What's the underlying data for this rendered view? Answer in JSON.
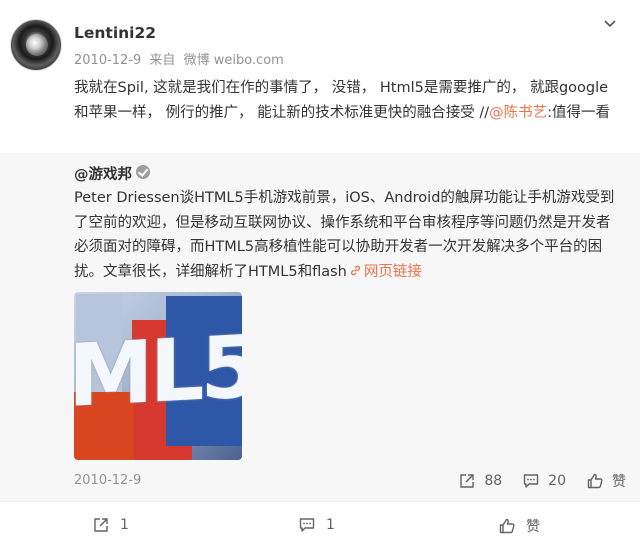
{
  "post": {
    "username": "Lentini22",
    "date": "2010-12-9",
    "source_prefix": "来自",
    "source": "微博 weibo.com",
    "text_main": "我就在Spil, 这就是我们在作的事情了， 没错， Html5是需要推广的， 就跟google和苹果一样， 例行的推广， 能让新的技术标准更快的融合接受 //",
    "mention": "@陈书艺",
    "text_tail": ":值得一看"
  },
  "repost": {
    "author": "@游戏邦",
    "text": "Peter Driessen谈HTML5手机游戏前景，iOS、Android的触屏功能让手机游戏受到了空前的欢迎，但是移动互联网协议、操作系统和平台审核程序等问题仍然是开发者必须面对的障碍，而HTML5高移植性能可以协助开发者一次开发解决多个平台的困扰。文章很长，详细解析了HTML5和flash",
    "link_label": "网页链接",
    "image_text": "ML5",
    "date": "2010-12-9",
    "reposts": "88",
    "comments": "20",
    "like_label": "赞"
  },
  "actions": {
    "reposts": "1",
    "comments": "1",
    "like_label": "赞"
  },
  "icons": {
    "chevron": "chevron-down-icon",
    "repost": "repost-icon",
    "comment": "comment-icon",
    "like": "like-icon",
    "link": "link-icon",
    "verified": "verified-badge-icon"
  },
  "colors": {
    "accent": "#eb7350",
    "meta": "#939393",
    "repost_bg": "#f7f7f7"
  }
}
